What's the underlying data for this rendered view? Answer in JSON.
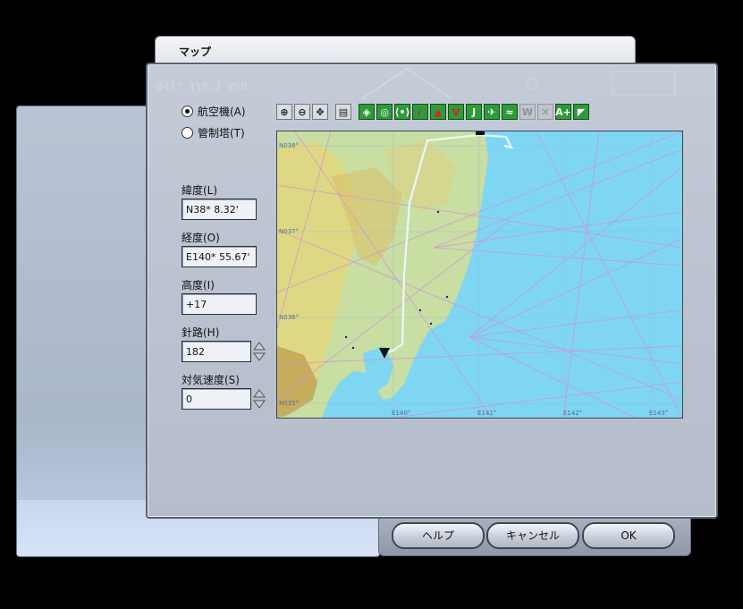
{
  "window": {
    "title": "マップ"
  },
  "mode": {
    "aircraft_label": "航空機(A)",
    "tower_label": "管制塔(T)",
    "selected": "aircraft"
  },
  "fields": {
    "latitude": {
      "label": "緯度(L)",
      "value": "N38* 8.32'"
    },
    "longitude": {
      "label": "経度(O)",
      "value": "E140* 55.67'"
    },
    "altitude": {
      "label": "高度(I)",
      "value": "+17"
    },
    "heading": {
      "label": "針路(H)",
      "value": "182"
    },
    "airspeed": {
      "label": "対気速度(S)",
      "value": "0"
    }
  },
  "toolbar": {
    "buttons": [
      {
        "name": "zoom-in-icon",
        "glyph": "⊕"
      },
      {
        "name": "zoom-out-icon",
        "glyph": "⊖"
      },
      {
        "name": "center-icon",
        "glyph": "✥"
      },
      {
        "name": "print-icon",
        "glyph": "▤"
      },
      {
        "name": "vor-icon",
        "glyph": "◈"
      },
      {
        "name": "ndb-icon",
        "glyph": "◎"
      },
      {
        "name": "ils-icon",
        "glyph": "⟨•⟩"
      },
      {
        "name": "check-icon",
        "glyph": "✓"
      },
      {
        "name": "intersection-icon",
        "glyph": "▲"
      },
      {
        "name": "victor-airway-icon",
        "glyph": "V"
      },
      {
        "name": "jet-airway-icon",
        "glyph": "J"
      },
      {
        "name": "airport-icon",
        "glyph": "✈"
      },
      {
        "name": "route-icon",
        "glyph": "≈"
      },
      {
        "name": "weather-icon",
        "glyph": "W"
      },
      {
        "name": "wind-icon",
        "glyph": "✕"
      },
      {
        "name": "text-icon",
        "glyph": "A+"
      },
      {
        "name": "terrain-icon",
        "glyph": "◤"
      }
    ]
  },
  "map": {
    "lat_labels": [
      "N038°",
      "N037°",
      "N036°",
      "N035°"
    ],
    "lon_labels": [
      "E140°",
      "E141°",
      "E142°",
      "E143°"
    ],
    "colors": {
      "sea": "#7ed6f2",
      "land": "#c7dea0",
      "route": "#e8f6ff",
      "airway": "#d88ad8"
    }
  },
  "buttons": {
    "help": "ヘルプ",
    "cancel": "キャンセル",
    "ok": "OK"
  },
  "background_text": {
    "vor_readout": "041° 110.3 VSN"
  }
}
